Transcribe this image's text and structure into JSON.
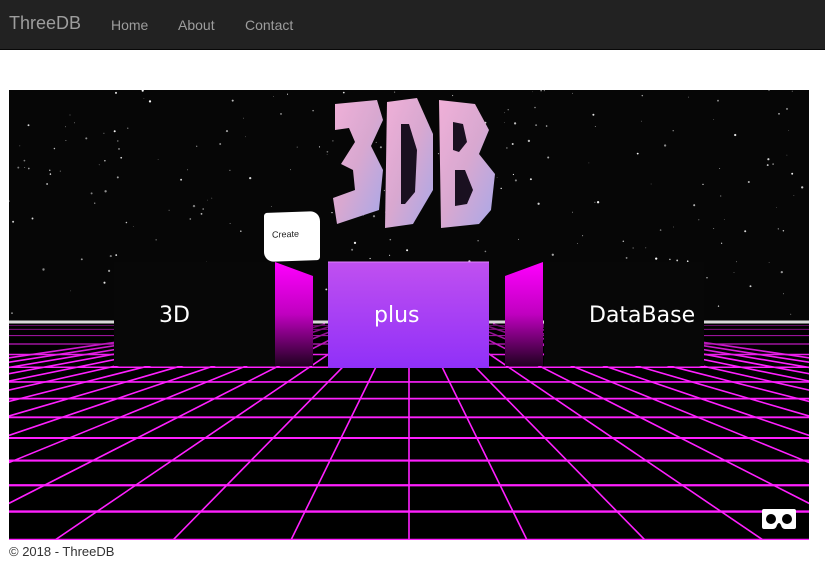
{
  "navbar": {
    "brand": "ThreeDB",
    "links": [
      "Home",
      "About",
      "Contact"
    ]
  },
  "scene": {
    "logo": "3DB",
    "create_label": "Create",
    "panels": [
      "3D",
      "plus",
      "DataBase"
    ],
    "vr_icon": "vr-goggles-icon",
    "colors": {
      "grid": "#ff20ff",
      "center_panel": "#a040f0",
      "side_wall": "#ff00ff"
    }
  },
  "footer": {
    "text": "© 2018 - ThreeDB"
  }
}
